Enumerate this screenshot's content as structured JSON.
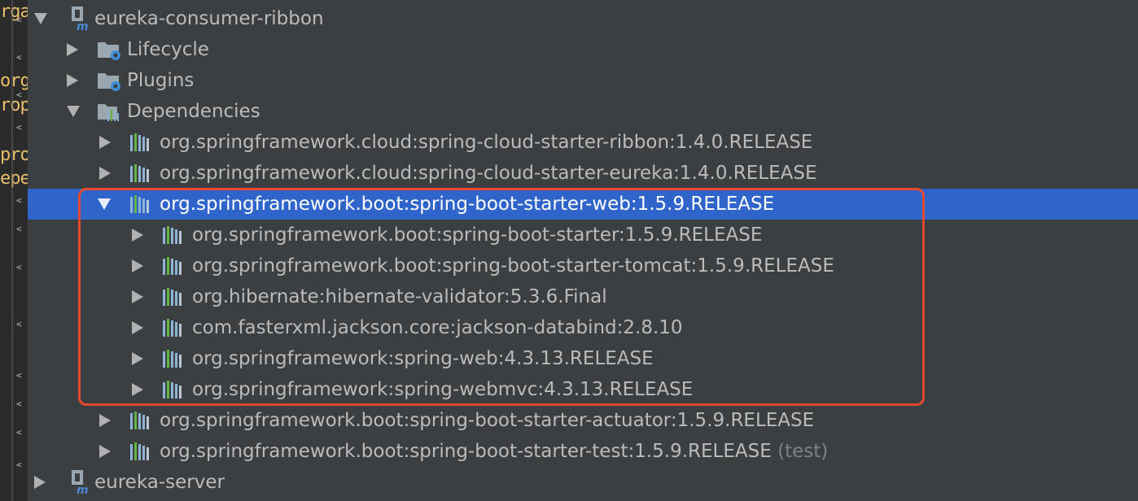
{
  "gutter": {
    "fragments": [
      "rga",
      "org",
      "rop",
      "pro",
      "epe"
    ]
  },
  "tree": {
    "modules": [
      {
        "label": "eureka-consumer-ribbon",
        "expanded": true
      },
      {
        "label": "eureka-server",
        "expanded": false
      }
    ],
    "groups": [
      {
        "label": "Lifecycle"
      },
      {
        "label": "Plugins"
      },
      {
        "label": "Dependencies"
      }
    ],
    "dependencies": [
      {
        "label": "org.springframework.cloud:spring-cloud-starter-ribbon:1.4.0.RELEASE"
      },
      {
        "label": "org.springframework.cloud:spring-cloud-starter-eureka:1.4.0.RELEASE"
      },
      {
        "label": "org.springframework.boot:spring-boot-starter-web:1.5.9.RELEASE",
        "selected": true,
        "expanded": true
      },
      {
        "label": "org.springframework.boot:spring-boot-starter-actuator:1.5.9.RELEASE"
      },
      {
        "label": "org.springframework.boot:spring-boot-starter-test:1.5.9.RELEASE",
        "scope": "(test)"
      }
    ],
    "sub_dependencies": [
      {
        "label": "org.springframework.boot:spring-boot-starter:1.5.9.RELEASE"
      },
      {
        "label": "org.springframework.boot:spring-boot-starter-tomcat:1.5.9.RELEASE"
      },
      {
        "label": "org.hibernate:hibernate-validator:5.3.6.Final"
      },
      {
        "label": "com.fasterxml.jackson.core:jackson-databind:2.8.10"
      },
      {
        "label": "org.springframework:spring-web:4.3.13.RELEASE"
      },
      {
        "label": "org.springframework:spring-webmvc:4.3.13.RELEASE"
      }
    ]
  },
  "colors": {
    "background": "#3c3f41",
    "selection": "#2f65ca",
    "highlight_box": "#e8492e",
    "text": "#bbbbbb"
  },
  "icons": {
    "module": "maven-module-icon",
    "folder": "folder-gear-icon",
    "dependencies": "dependencies-folder-icon",
    "library": "library-bars-icon"
  }
}
